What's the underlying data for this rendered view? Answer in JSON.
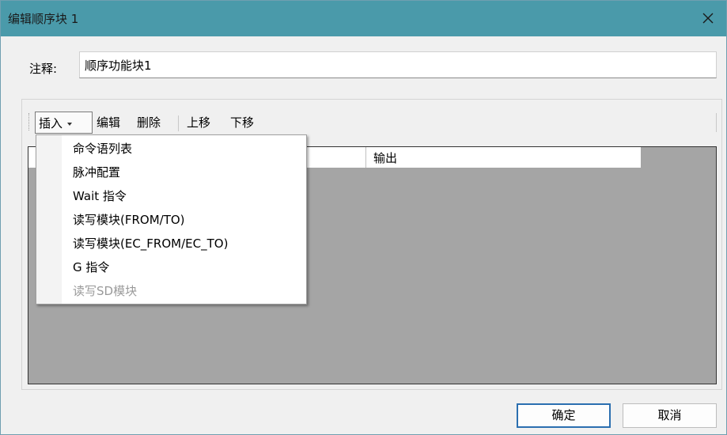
{
  "window": {
    "title": "编辑顺序块 1"
  },
  "form": {
    "comment_label": "注释:",
    "comment_value": "顺序功能块1"
  },
  "toolbar": {
    "insert": "插入",
    "edit": "编辑",
    "delete": "删除",
    "move_up": "上移",
    "move_down": "下移"
  },
  "grid": {
    "columns": [
      "",
      "输出"
    ]
  },
  "insert_menu": {
    "items": [
      {
        "label": "命令语列表",
        "enabled": true
      },
      {
        "label": "脉冲配置",
        "enabled": true
      },
      {
        "label": "Wait 指令",
        "enabled": true
      },
      {
        "label": "读写模块(FROM/TO)",
        "enabled": true
      },
      {
        "label": "读写模块(EC_FROM/EC_TO)",
        "enabled": true
      },
      {
        "label": "G 指令",
        "enabled": true
      },
      {
        "label": "读写SD模块",
        "enabled": false
      }
    ]
  },
  "buttons": {
    "ok": "确定",
    "cancel": "取消"
  },
  "colors": {
    "titlebar": "#4a9aaa",
    "dialog_bg": "#f0f0f0",
    "grid_bg": "#a5a5a5",
    "default_button_border": "#2b6fb0",
    "disabled_text": "#9a9a9a"
  },
  "icons": {
    "close": "close-icon",
    "dropdown": "dropdown-arrow-icon"
  }
}
